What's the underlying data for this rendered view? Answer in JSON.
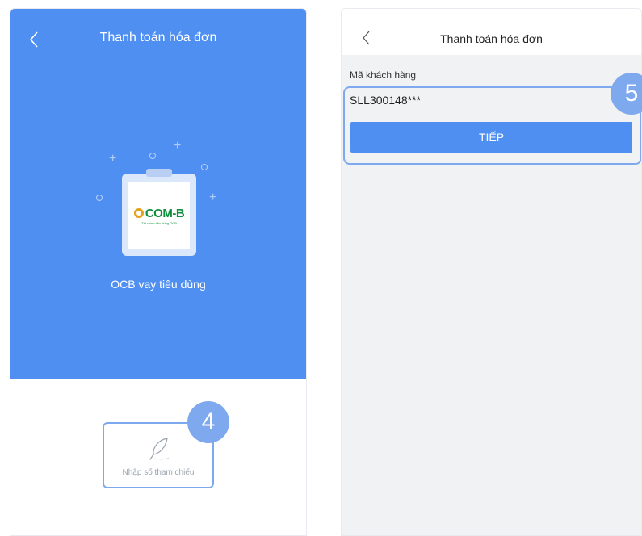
{
  "left_screen": {
    "title": "Thanh toán hóa đơn",
    "logo_text": "COM-B",
    "logo_subtitle": "Tài chính tiêu dùng OCB",
    "service_name": "OCB vay tiêu dùng",
    "reference_label": "Nhập số tham chiếu",
    "step_badge": "4"
  },
  "right_screen": {
    "title": "Thanh toán hóa đơn",
    "field_label": "Mã khách hàng",
    "customer_code_value": "SLL300148***",
    "next_button_label": "TIẾP",
    "step_badge": "5"
  },
  "colors": {
    "primary_blue": "#4f8ff2",
    "badge_blue": "#7fa9ee",
    "logo_green": "#0f8f3b",
    "logo_gold": "#e6a21b"
  },
  "icons": {
    "back": "chevron-left-icon",
    "feather": "feather-icon",
    "decor": "plus-and-circle-sparkles"
  }
}
